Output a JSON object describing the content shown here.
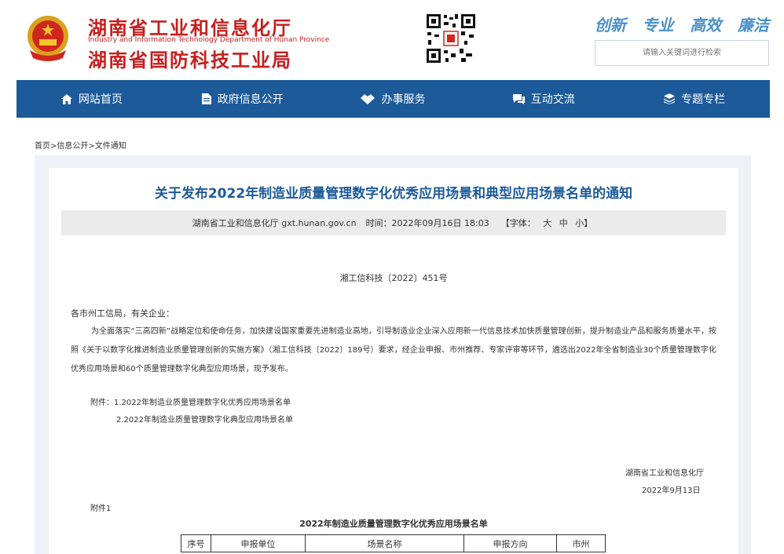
{
  "header": {
    "name_line1": "湖南省工业和信息化厅",
    "name_en": "Industry and Information Technology Department of Hunan Province",
    "name_line2": "湖南省国防科技工业局",
    "slogan": [
      "创新",
      "专业",
      "高效",
      "廉洁"
    ],
    "search_placeholder": "请输入关键词进行检索"
  },
  "nav": [
    {
      "label": "网站首页",
      "icon": "home-icon"
    },
    {
      "label": "政府信息公开",
      "icon": "document-icon"
    },
    {
      "label": "办事服务",
      "icon": "service-icon"
    },
    {
      "label": "互动交流",
      "icon": "chat-icon"
    },
    {
      "label": "专题专栏",
      "icon": "layers-icon"
    }
  ],
  "breadcrumb": "首页>信息公开>文件通知",
  "article": {
    "title": "关于发布2022年制造业质量管理数字化优秀应用场景和典型应用场景名单的通知",
    "meta_source": "湖南省工业和信息化厅 gxt.hunan.gov.cn",
    "meta_time": "时间：2022年09月16日 18:03",
    "meta_font_label": "【字体：",
    "meta_font_large": "大",
    "meta_font_medium": "中",
    "meta_font_small": "小】",
    "doc_no": "湘工信科技〔2022〕451号",
    "addressee": "各市州工信局，有关企业：",
    "body": "为全面落实“三高四新”战略定位和使命任务，加快建设国家重要先进制造业高地，引导制造业企业深入应用新一代信息技术加快质量管理创新，提升制造业产品和服务质量水平，按照《关于以数字化推进制造业质量管理创新的实施方案》（湘工信科技〔2022〕189号）要求，经企业申报、市州推荐、专家评审等环节，遴选出2022年全省制造业30个质量管理数字化优秀应用场景和60个质量管理数字化典型应用场景，现予发布。",
    "attachment1": "附件：1.2022年制造业质量管理数字化优秀应用场景名单",
    "attachment2": "2.2022年制造业质量管理数字化典型应用场景名单",
    "sign_org": "湖南省工业和信息化厅",
    "sign_date": "2022年9月13日",
    "attach_label": "附件1",
    "table_title": "2022年制造业质量管理数字化优秀应用场景名单",
    "table_headers": [
      "序号",
      "申报单位",
      "场景名称",
      "申报方向",
      "市州"
    ]
  },
  "colors": {
    "brand_red": "#c81e1e",
    "nav_blue": "#1c5a9a",
    "slogan_blue": "#4a90c8"
  }
}
